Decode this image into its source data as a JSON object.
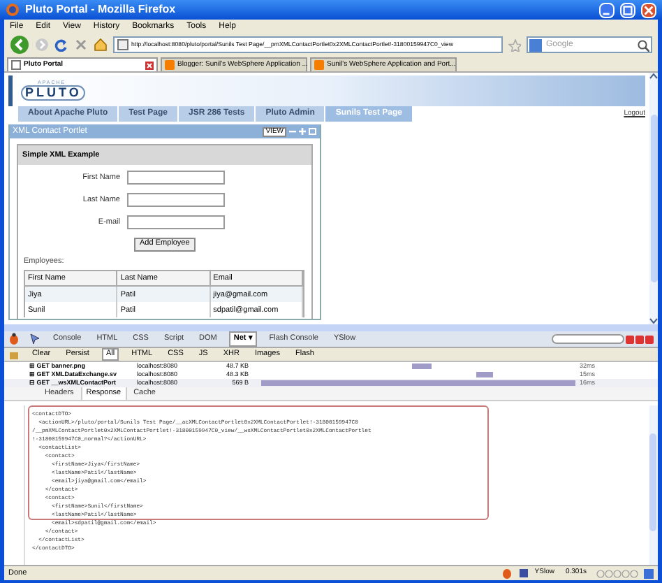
{
  "window": {
    "title": "Pluto Portal - Mozilla Firefox"
  },
  "menu": [
    "File",
    "Edit",
    "View",
    "History",
    "Bookmarks",
    "Tools",
    "Help"
  ],
  "address_bar": {
    "value": "http://localhost:8080/pluto/portal/Sunils Test Page/__pmXMLContactPortlet0x2XMLContactPortlet!-31800159947C0_view"
  },
  "search": {
    "placeholder": "Google"
  },
  "browser_tabs": [
    {
      "label": "Pluto Portal",
      "selected": true
    },
    {
      "label": "Blogger: Sunil's WebSphere Application ...",
      "selected": false
    },
    {
      "label": "Sunil's WebSphere Application and Port...",
      "selected": false
    }
  ],
  "logo": {
    "top": "APACHE",
    "main": "PLUTO"
  },
  "portal_tabs": [
    {
      "label": "About Apache Pluto",
      "selected": false
    },
    {
      "label": "Test Page",
      "selected": false
    },
    {
      "label": "JSR 286 Tests",
      "selected": false
    },
    {
      "label": "Pluto Admin",
      "selected": false
    },
    {
      "label": "Sunils Test Page",
      "selected": true
    }
  ],
  "logout": "Logout",
  "portlet": {
    "title": "XML Contact Portlet",
    "mode": "VIEW",
    "section": "Simple XML Example",
    "fields": [
      {
        "label": "First Name"
      },
      {
        "label": "Last Name"
      },
      {
        "label": "E-mail"
      }
    ],
    "button": "Add Employee",
    "list_label": "Employees:",
    "table": {
      "columns": [
        "First Name",
        "Last Name",
        "Email"
      ],
      "rows": [
        [
          "Jiya",
          "Patil",
          "jiya@gmail.com"
        ],
        [
          "Sunil",
          "Patil",
          "sdpatil@gmail.com"
        ]
      ]
    }
  },
  "firebug": {
    "tabs": [
      {
        "label": "Console",
        "selected": false
      },
      {
        "label": "HTML",
        "selected": false
      },
      {
        "label": "CSS",
        "selected": false
      },
      {
        "label": "Script",
        "selected": false
      },
      {
        "label": "DOM",
        "selected": false
      },
      {
        "label": "Net ▾",
        "selected": true
      },
      {
        "label": "Flash Console",
        "selected": false
      },
      {
        "label": "YSlow",
        "selected": false
      }
    ],
    "filters": [
      {
        "label": "Clear",
        "selected": false
      },
      {
        "label": "Persist",
        "selected": false
      },
      {
        "label": "All",
        "selected": true
      },
      {
        "label": "HTML",
        "selected": false
      },
      {
        "label": "CSS",
        "selected": false
      },
      {
        "label": "JS",
        "selected": false
      },
      {
        "label": "XHR",
        "selected": false
      },
      {
        "label": "Images",
        "selected": false
      },
      {
        "label": "Flash",
        "selected": false
      }
    ],
    "requests": [
      {
        "toggle": "⊞",
        "url": "GET banner.png",
        "host": "localhost:8080",
        "size": "48.7 KB",
        "time": "32ms",
        "expanded": false
      },
      {
        "toggle": "⊞",
        "url": "GET XMLDataExchange.sv",
        "host": "localhost:8080",
        "size": "48.3 KB",
        "time": "15ms",
        "expanded": false
      },
      {
        "toggle": "⊟",
        "url": "GET __wsXMLContactPort",
        "host": "localhost:8080",
        "size": "569 B",
        "time": "16ms",
        "expanded": true
      }
    ],
    "detail_tabs": [
      {
        "label": "Headers",
        "selected": false
      },
      {
        "label": "Response",
        "selected": true
      },
      {
        "label": "Cache",
        "selected": false
      }
    ],
    "response_lines": [
      "<contactDTO>",
      "  <actionURL>/pluto/portal/Sunils Test Page/__acXMLContactPortlet0x2XMLContactPortlet!-31800159947C0",
      "/__pmXMLContactPortlet0x2XMLContactPortlet!-31800159947C0_view/__wsXMLContactPortlet0x2XMLContactPortlet",
      "!-31800159947C0_normal?</actionURL>",
      "  <contactList>",
      "    <contact>",
      "      <firstName>Jiya</firstName>",
      "      <lastName>Patil</lastName>",
      "      <email>jiya@gmail.com</email>",
      "    </contact>",
      "    <contact>",
      "      <firstName>Sunil</firstName>",
      "      <lastName>Patil</lastName>",
      "      <email>sdpatil@gmail.com</email>",
      "    </contact>",
      "  </contactList>",
      "</contactDTO>"
    ]
  },
  "status_bar": {
    "text": "Done",
    "yslow": "YSlow",
    "time": "0.301s"
  }
}
